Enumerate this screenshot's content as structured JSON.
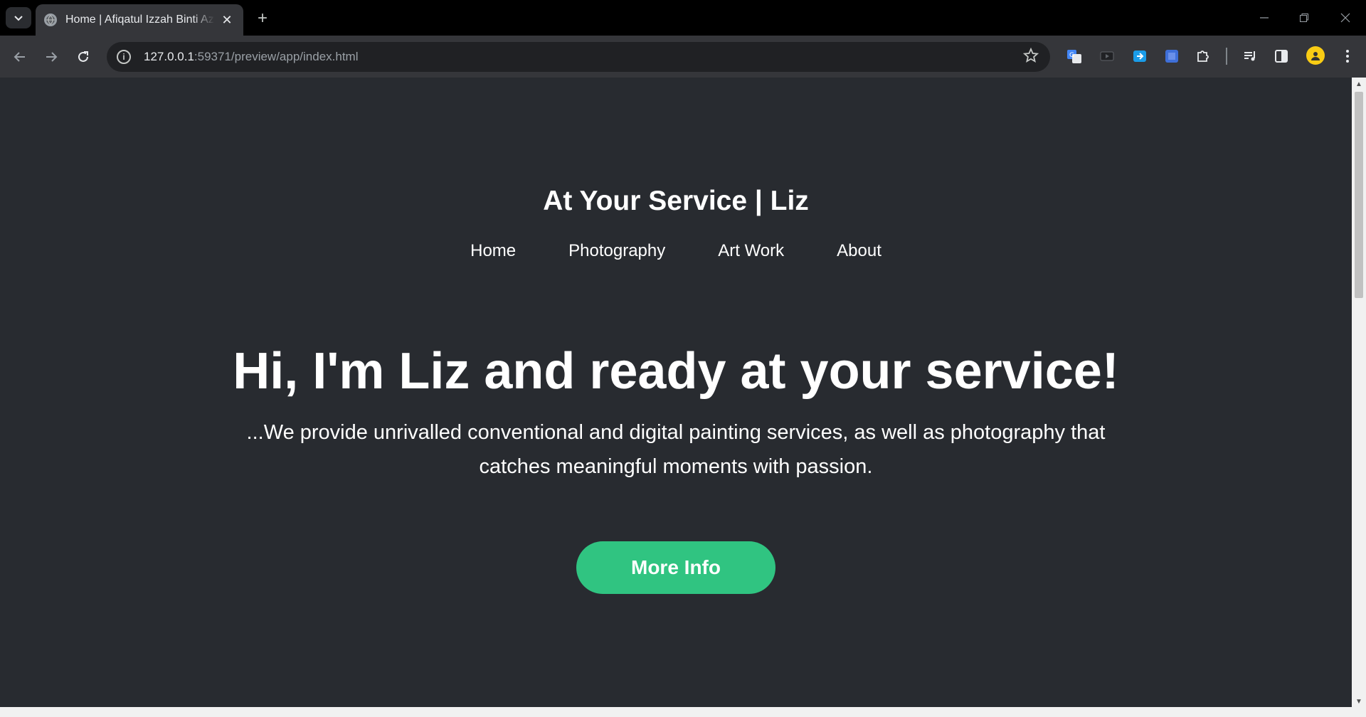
{
  "browser": {
    "tab_title": "Home | Afiqatul Izzah Binti Azhar",
    "tab_close": "✕",
    "new_tab": "+",
    "url_host": "127.0.0.1",
    "url_path": ":59371/preview/app/index.html"
  },
  "site": {
    "title": "At Your Service | Liz",
    "nav": [
      "Home",
      "Photography",
      "Art Work",
      "About"
    ],
    "hero_title": "Hi, I'm Liz and ready at your service!",
    "hero_subtitle": "...We provide unrivalled conventional and digital painting services, as well as photography that catches meaningful moments with passion.",
    "cta_label": "More Info"
  },
  "colors": {
    "page_bg": "#282b30",
    "cta_bg": "#30c481",
    "browser_frame": "#35363a"
  }
}
